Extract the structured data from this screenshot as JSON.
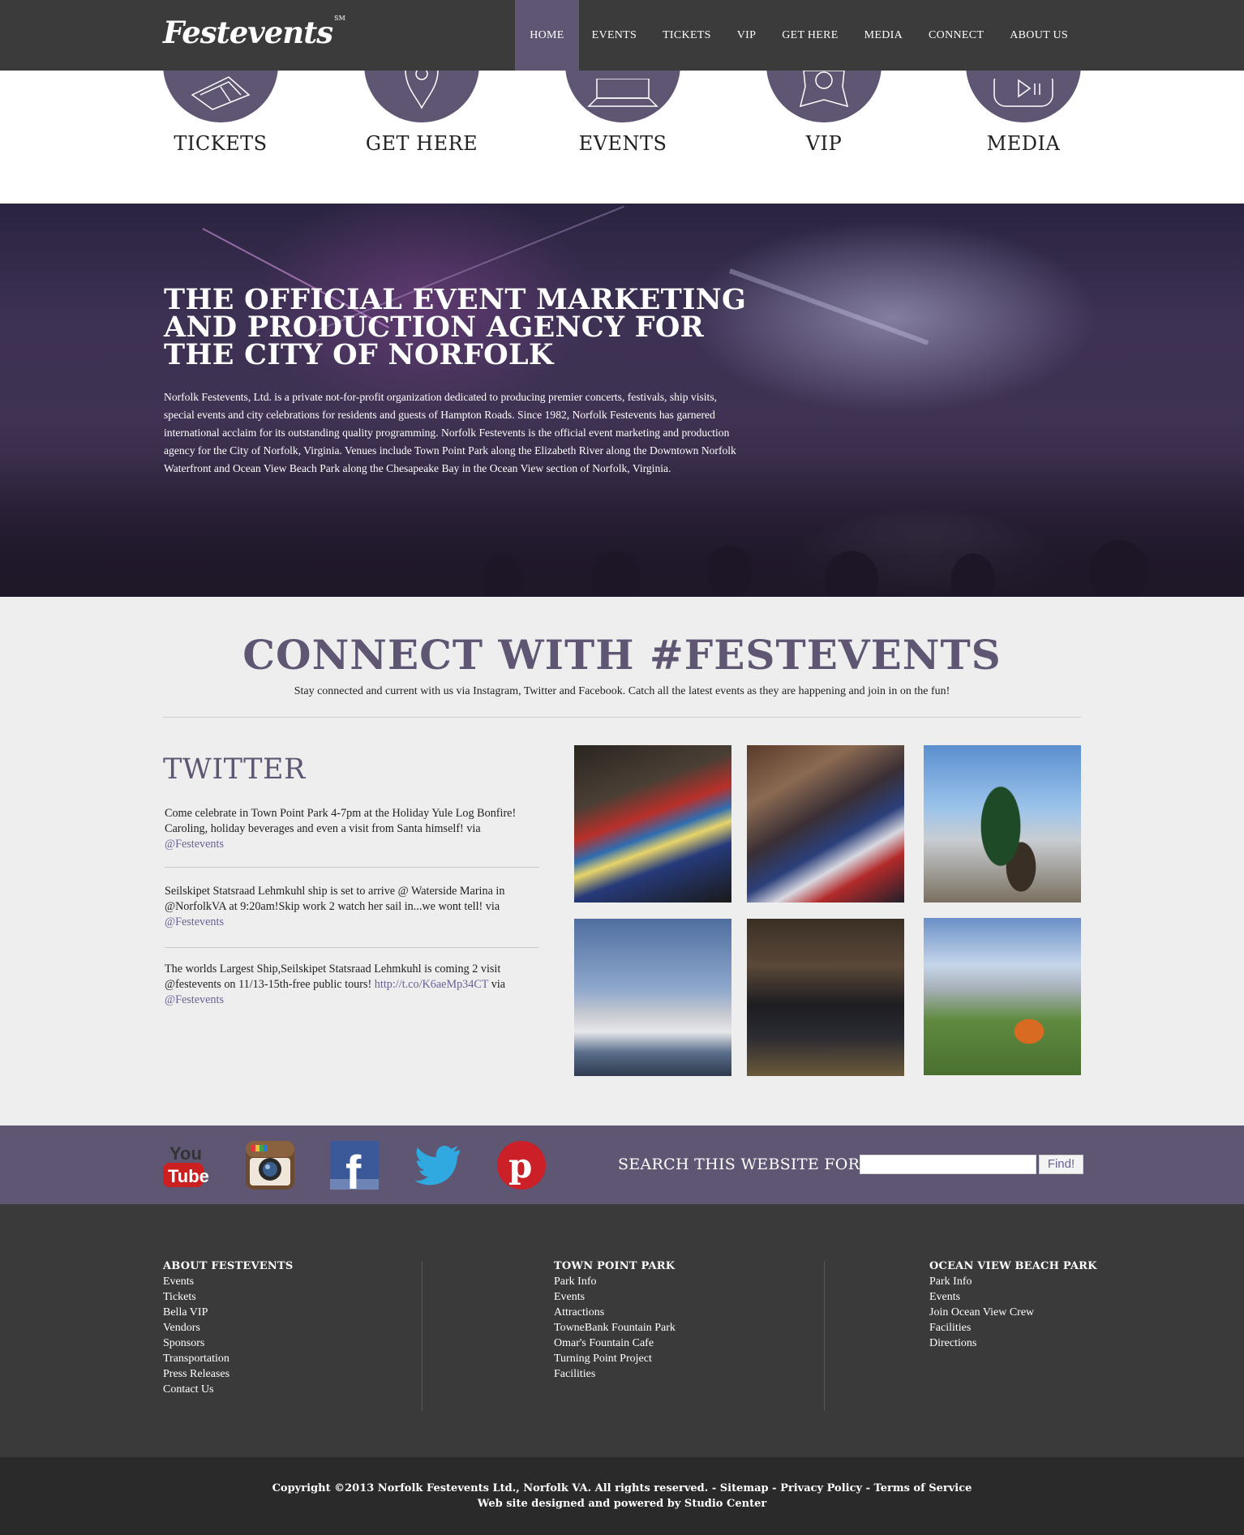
{
  "nav": {
    "logo": "Festevents",
    "logo_mark": "SM",
    "items": [
      {
        "label": "HOME",
        "active": true
      },
      {
        "label": "EVENTS"
      },
      {
        "label": "TICKETS"
      },
      {
        "label": "VIP"
      },
      {
        "label": "GET HERE"
      },
      {
        "label": "MEDIA"
      },
      {
        "label": "CONNECT"
      },
      {
        "label": "ABOUT US"
      }
    ]
  },
  "quick_links": [
    {
      "label": "TICKETS",
      "icon": "tickets-icon"
    },
    {
      "label": "GET HERE",
      "icon": "map-pin-icon"
    },
    {
      "label": "EVENTS",
      "icon": "laptop-icon"
    },
    {
      "label": "VIP",
      "icon": "star-badge-icon"
    },
    {
      "label": "MEDIA",
      "icon": "play-icon"
    }
  ],
  "hero": {
    "title": "THE OFFICIAL EVENT MARKETING AND PRODUCTION AGENCY FOR THE CITY OF NORFOLK",
    "body": "Norfolk Festevents, Ltd. is a private not-for-profit organization dedicated to producing premier concerts, festivals, ship visits, special events and city celebrations for residents and guests of Hampton Roads. Since 1982, Norfolk Festevents has garnered international acclaim for its outstanding quality programming. Norfolk Festevents is the official event marketing and production agency for the City of Norfolk, Virginia. Venues include Town Point Park along the Elizabeth River along the Downtown Norfolk Waterfront and Ocean View Beach Park along the Chesapeake Bay in the Ocean View section of Norfolk, Virginia."
  },
  "connect": {
    "title": "CONNECT WITH #FESTEVENTS",
    "subtitle": "Stay connected and current with us via Instagram, Twitter and Facebook. Catch all the latest events as they are happening and join in on the fun!",
    "twitter_title": "TWITTER",
    "tweets": [
      {
        "text": "Come celebrate in Town Point Park 4-7pm at the Holiday Yule Log Bonfire! Caroling, holiday beverages and even a visit from Santa himself! via",
        "link": "",
        "handle": "@Festevents"
      },
      {
        "text": "Seilskipet Statsraad Lehmkuhl ship is set to arrive @ Waterside Marina in @NorfolkVA at 9:20am!Skip work 2 watch her sail in...we wont tell! via",
        "link": "",
        "handle": "@Festevents"
      },
      {
        "text": "The worlds Largest Ship,Seilskipet Statsraad Lehmkuhl is coming 2 visit @festevents on 11/13-15th-free public tours!",
        "link": "http://t.co/K6aeMp34CT",
        "via": "via",
        "handle": "@Festevents"
      }
    ]
  },
  "social": {
    "icons": [
      "youtube-icon",
      "instagram-icon",
      "facebook-icon",
      "twitter-icon",
      "pinterest-icon"
    ],
    "youtube_word1": "You",
    "youtube_word2": "Tube",
    "facebook_letter": "f",
    "pinterest_letter": "p",
    "search_label": "SEARCH THIS WEBSITE FOR:",
    "search_value": "",
    "search_button": "Find!"
  },
  "footer": {
    "columns": [
      {
        "title": "ABOUT FESTEVENTS",
        "links": [
          "Events",
          "Tickets",
          "Bella VIP",
          "Vendors",
          "Sponsors",
          "Transportation",
          "Press Releases",
          "Contact Us"
        ]
      },
      {
        "title": "TOWN POINT PARK",
        "links": [
          "Park Info",
          "Events",
          "Attractions",
          "TowneBank Fountain Park",
          "Omar's Fountain Cafe",
          "Turning Point Project",
          "Facilities"
        ]
      },
      {
        "title": "OCEAN VIEW BEACH PARK",
        "links": [
          "Park Info",
          "Events",
          "Join Ocean View Crew",
          "Facilities",
          "Directions"
        ]
      }
    ]
  },
  "copyright": {
    "line1_prefix": "Copyright ©2013 Norfolk Festevents Ltd., Norfolk VA. All rights reserved. -",
    "sitemap": "Sitemap",
    "privacy": "Privacy Policy",
    "terms": "Terms of Service",
    "line2": "Web site designed and powered by Studio Center"
  },
  "colors": {
    "nav_bg": "#3b3b3b",
    "accent_purple": "#5f5673",
    "connect_bg": "#eeeeee",
    "footer_bg": "#3a3a3a",
    "copyright_bg": "#2a2a2a"
  }
}
